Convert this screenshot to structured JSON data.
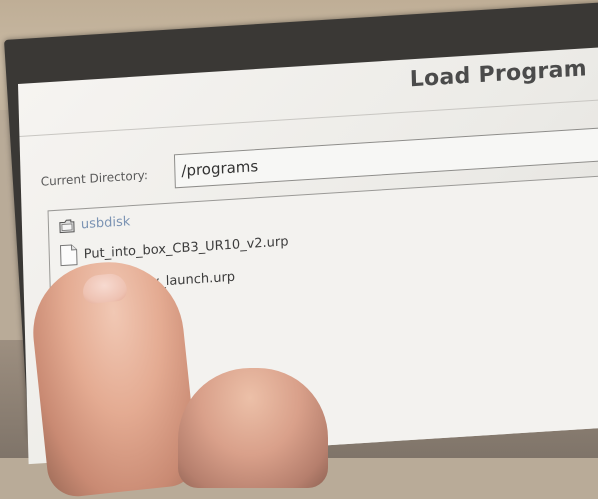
{
  "window": {
    "title": "Load Program"
  },
  "directory": {
    "label": "Current Directory:",
    "value": "/programs"
  },
  "files": {
    "folder": {
      "name": "usbdisk",
      "icon": "folder-icon"
    },
    "items": [
      {
        "name": "Put_into_box_CB3_UR10_v2.urp",
        "icon": "document-icon"
      },
      {
        "name": "ty_launch.urp",
        "icon": "document-icon"
      }
    ]
  },
  "colors": {
    "folder_text": "#7b93b3",
    "screen_bg": "#f1f0ed"
  }
}
